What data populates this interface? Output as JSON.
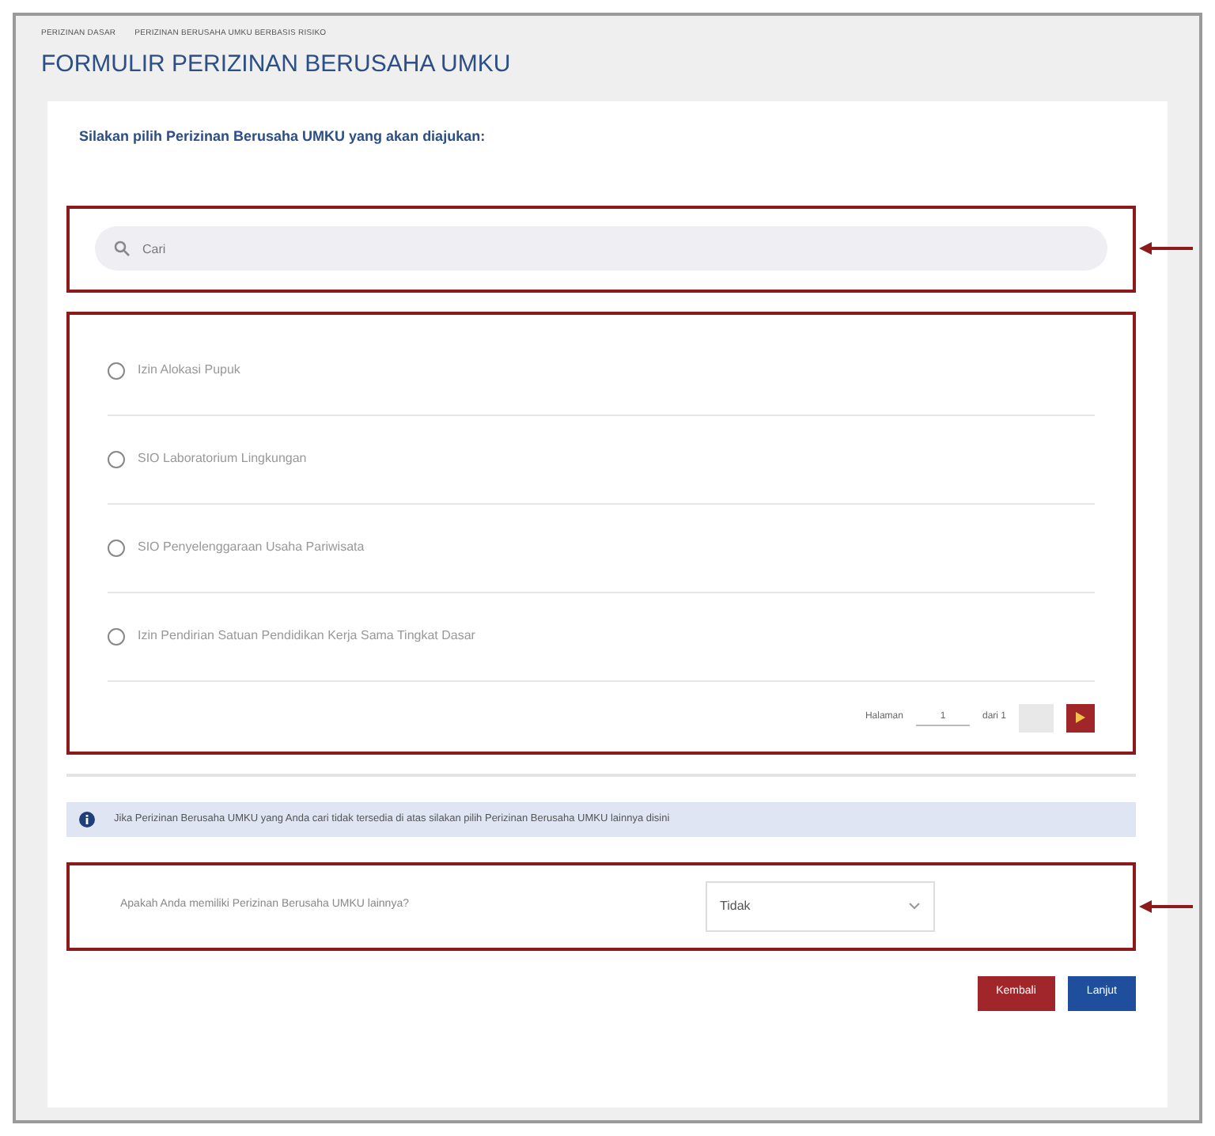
{
  "breadcrumb": [
    "PERIZINAN DASAR",
    "PERIZINAN BERUSAHA UMKU BERBASIS RISIKO"
  ],
  "title": "FORMULIR PERIZINAN BERUSAHA UMKU",
  "instruction": "Silakan pilih Perizinan Berusaha UMKU yang akan diajukan:",
  "search": {
    "placeholder": "Cari"
  },
  "options": [
    {
      "label": "Izin Alokasi Pupuk",
      "selected": false
    },
    {
      "label": "SIO Laboratorium Lingkungan",
      "selected": false
    },
    {
      "label": "SIO Penyelenggaraan Usaha Pariwisata",
      "selected": false
    },
    {
      "label": "Izin Pendirian Satuan Pendidikan Kerja Sama Tingkat Dasar",
      "selected": false
    }
  ],
  "pagination": {
    "label": "Halaman",
    "page": "1",
    "total": "dari 1"
  },
  "info": "Jika Perizinan Berusaha UMKU yang Anda cari tidak tersedia di atas silakan pilih Perizinan Berusaha UMKU lainnya disini",
  "question": {
    "label": "Apakah Anda memiliki Perizinan Berusaha UMKU lainnya?",
    "value": "Tidak"
  },
  "buttons": [
    {
      "label": "Kembali",
      "kind": "back"
    },
    {
      "label": "Lanjut",
      "kind": "next"
    }
  ]
}
